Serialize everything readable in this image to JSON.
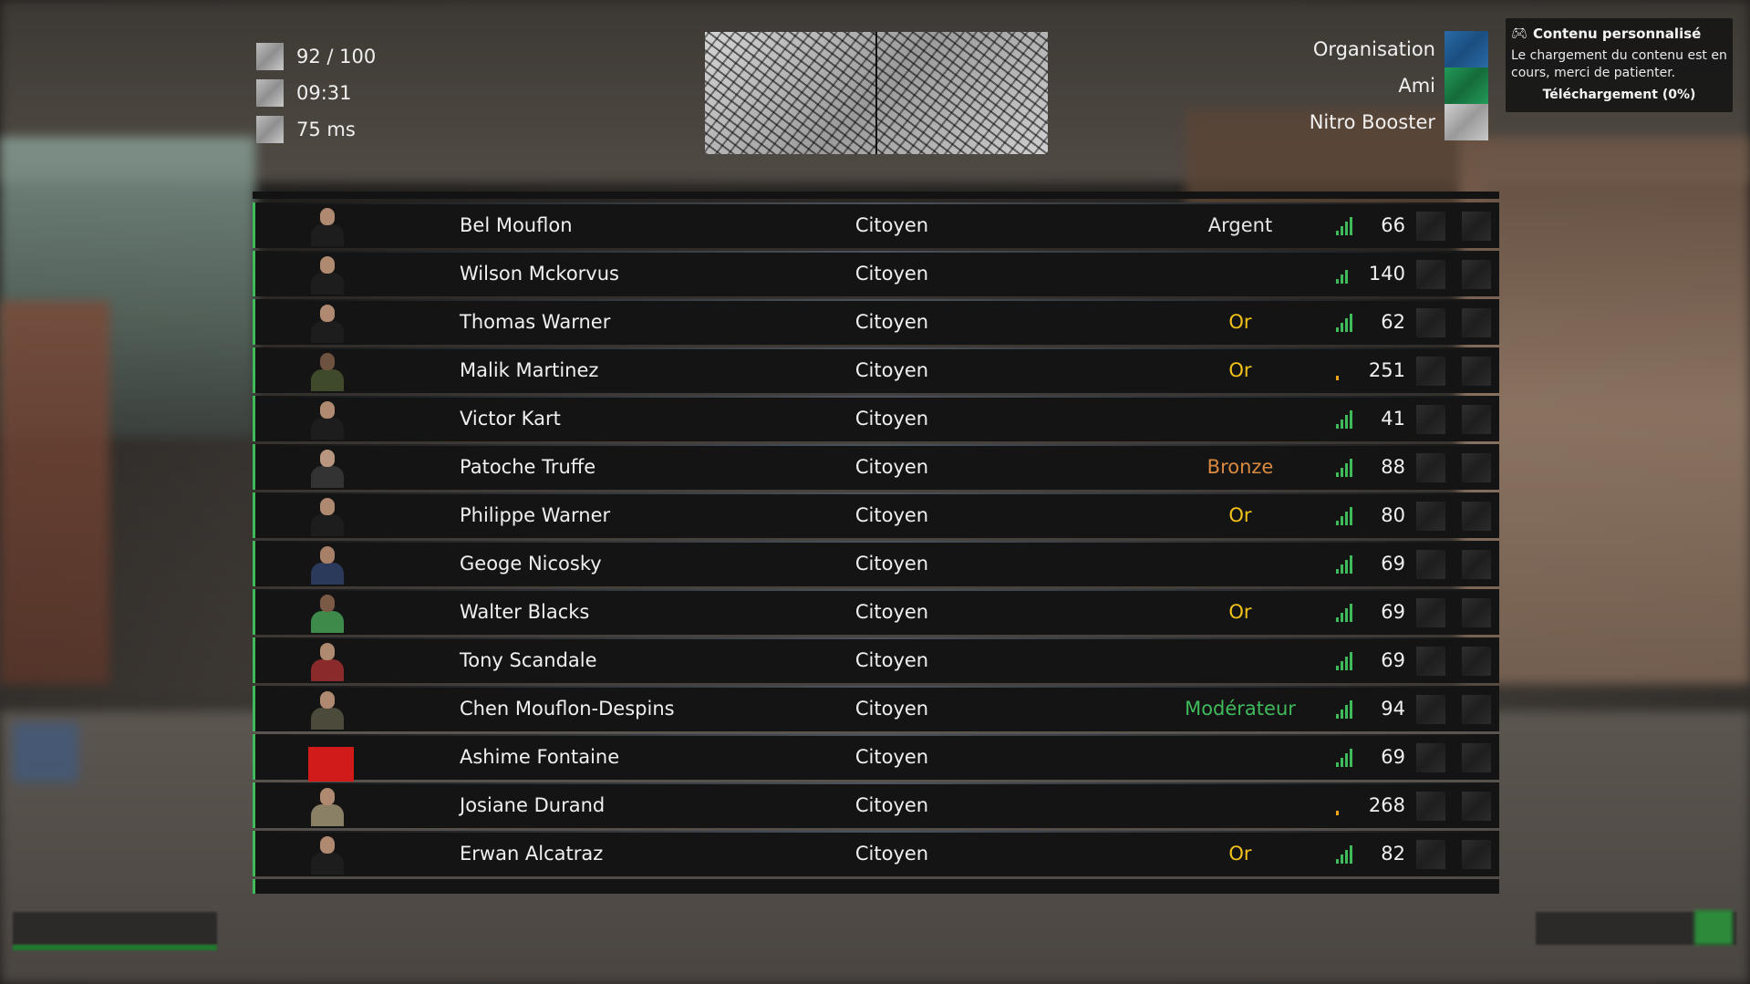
{
  "stats": [
    {
      "icon": "players-icon",
      "text": "92 / 100"
    },
    {
      "icon": "clock-icon",
      "text": "09:31"
    },
    {
      "icon": "ping-icon",
      "text": "75 ms"
    }
  ],
  "legend": [
    {
      "label": "Organisation",
      "color": "#1f5d96"
    },
    {
      "label": "Ami",
      "color": "#1c8a4c"
    },
    {
      "label": "Nitro Booster",
      "color": "#b8b8b8"
    }
  ],
  "notification": {
    "title": "Contenu personnalisé",
    "body": "Le chargement du contenu est en cours, merci de patienter.",
    "footer": "Téléchargement (0%)"
  },
  "colors": {
    "accent_green": "#3fbb5c",
    "rank_argent": "#e6e6e6",
    "rank_or": "#f2c21b",
    "rank_bronze": "#d98a3f",
    "rank_moderateur": "#3fbb5c",
    "signal_good": "#3fbb5c",
    "signal_bad": "#f2a51b"
  },
  "players": [
    {
      "name": "Bel Mouflon",
      "job": "Citoyen",
      "rank": "Argent",
      "rank_color": "#e6e6e6",
      "ping": "66",
      "signal": 4,
      "avatar": "dark"
    },
    {
      "name": "Wilson Mckorvus",
      "job": "Citoyen",
      "rank": "",
      "rank_color": "#e6e6e6",
      "ping": "140",
      "signal": 3,
      "avatar": "dark"
    },
    {
      "name": "Thomas Warner",
      "job": "Citoyen",
      "rank": "Or",
      "rank_color": "#f2c21b",
      "ping": "62",
      "signal": 4,
      "avatar": "dark"
    },
    {
      "name": "Malik Martinez",
      "job": "Citoyen",
      "rank": "Or",
      "rank_color": "#f2c21b",
      "ping": "251",
      "signal": 1,
      "avatar": "olive"
    },
    {
      "name": "Victor Kart",
      "job": "Citoyen",
      "rank": "",
      "rank_color": "#e6e6e6",
      "ping": "41",
      "signal": 4,
      "avatar": "dark"
    },
    {
      "name": "Patoche Truffe",
      "job": "Citoyen",
      "rank": "Bronze",
      "rank_color": "#d98a3f",
      "ping": "88",
      "signal": 4,
      "avatar": "grey"
    },
    {
      "name": "Philippe Warner",
      "job": "Citoyen",
      "rank": "Or",
      "rank_color": "#f2c21b",
      "ping": "80",
      "signal": 4,
      "avatar": "dark"
    },
    {
      "name": "Geoge Nicosky",
      "job": "Citoyen",
      "rank": "",
      "rank_color": "#e6e6e6",
      "ping": "69",
      "signal": 4,
      "avatar": "plaid"
    },
    {
      "name": "Walter Blacks",
      "job": "Citoyen",
      "rank": "Or",
      "rank_color": "#f2c21b",
      "ping": "69",
      "signal": 4,
      "avatar": "green"
    },
    {
      "name": "Tony Scandale",
      "job": "Citoyen",
      "rank": "",
      "rank_color": "#e6e6e6",
      "ping": "69",
      "signal": 4,
      "avatar": "red"
    },
    {
      "name": "Chen Mouflon-Despins",
      "job": "Citoyen",
      "rank": "Modérateur",
      "rank_color": "#3fbb5c",
      "ping": "94",
      "signal": 4,
      "avatar": "khaki"
    },
    {
      "name": "Ashime Fontaine",
      "job": "Citoyen",
      "rank": "",
      "rank_color": "#e6e6e6",
      "ping": "69",
      "signal": 4,
      "avatar": "error"
    },
    {
      "name": "Josiane Durand",
      "job": "Citoyen",
      "rank": "",
      "rank_color": "#e6e6e6",
      "ping": "268",
      "signal": 1,
      "avatar": "beige"
    },
    {
      "name": "Erwan Alcatraz",
      "job": "Citoyen",
      "rank": "Or",
      "rank_color": "#f2c21b",
      "ping": "82",
      "signal": 4,
      "avatar": "dark"
    }
  ]
}
